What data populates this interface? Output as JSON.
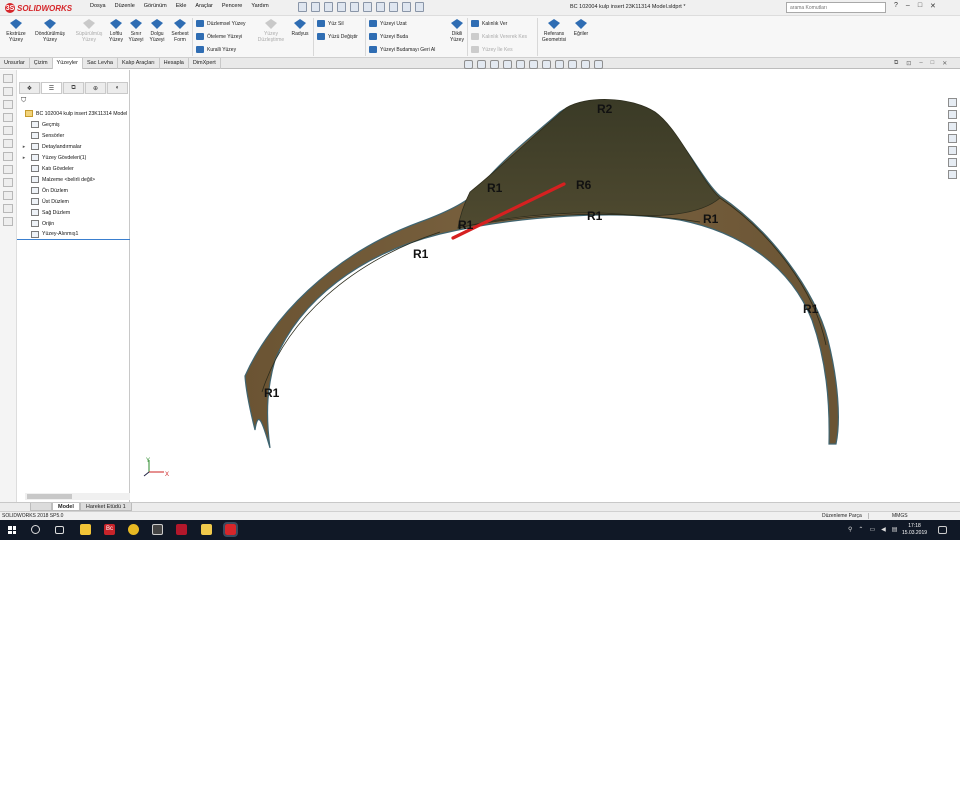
{
  "window": {
    "brand": "SOLIDWORKS",
    "brand_prefix": "3S",
    "document_title": "BC 102004 kulp insert 23K11314 Model.sldprt *",
    "search_placeholder": "arama Komutları",
    "controls": [
      "?",
      "–",
      "□",
      "✕"
    ]
  },
  "menu": [
    "Dosya",
    "Düzenle",
    "Görünüm",
    "Ekle",
    "Araçlar",
    "Pencere",
    "Yardım"
  ],
  "ribbon": {
    "big_buttons": [
      {
        "label1": "Ekstrüze",
        "label2": "Yüzey",
        "enabled": true
      },
      {
        "label1": "Döndürülmüş",
        "label2": "Yüzey",
        "enabled": true
      },
      {
        "label1": "Süpürülmüş",
        "label2": "Yüzey",
        "enabled": false
      },
      {
        "label1": "Loftlu",
        "label2": "Yüzey",
        "enabled": true
      },
      {
        "label1": "Sınır",
        "label2": "Yüzeyi",
        "enabled": true
      },
      {
        "label1": "Dolgu",
        "label2": "Yüzeyi",
        "enabled": true
      },
      {
        "label1": "Serbest",
        "label2": "Form",
        "enabled": true
      }
    ],
    "col1": [
      "Düzlemsel Yüzey",
      "Öteleme Yüzeyi",
      "Kuralli Yüzey"
    ],
    "radius": {
      "label": "Radyus"
    },
    "flatten": {
      "label1": "Yüzey",
      "label2": "Düzleştirme"
    },
    "col2": [
      "Yüz Sil",
      "Yüzü Değiştir"
    ],
    "col3": [
      "Yüzeyi Uzat",
      "Yüzeyi Buda",
      "Yüzeyi Budamayı Geri Al"
    ],
    "ruled": {
      "label1": "Dikili",
      "label2": "Yüzey"
    },
    "col4": [
      {
        "label": "Kalınlık Ver",
        "enabled": true
      },
      {
        "label": "Kalınlık Vererek Kes",
        "enabled": false
      },
      {
        "label": "Yüzey İle Kes",
        "enabled": false
      }
    ],
    "ref_geom": {
      "label1": "Referans",
      "label2": "Geometrisi"
    },
    "curves": {
      "label": "Eğriler"
    }
  },
  "tabs": [
    "Unsurlar",
    "Çizim",
    "Yüzeyler",
    "Sac Levha",
    "Kalıp Araçları",
    "Hesapla",
    "DimXpert"
  ],
  "active_tab": "Yüzeyler",
  "tree": [
    {
      "label": "BC 102004 kulp insert 23K11314 Model",
      "expand": ""
    },
    {
      "label": "Geçmiş",
      "expand": ""
    },
    {
      "label": "Sensörler",
      "expand": ""
    },
    {
      "label": "Detaylandırmalar",
      "expand": "▸"
    },
    {
      "label": "Yüzey Gövdeleri(1)",
      "expand": "▸"
    },
    {
      "label": "Katı Gövdeler",
      "expand": ""
    },
    {
      "label": "Malzeme <belirli değil>",
      "expand": ""
    },
    {
      "label": "Ön Düzlem",
      "expand": ""
    },
    {
      "label": "Üst Düzlem",
      "expand": ""
    },
    {
      "label": "Sağ Düzlem",
      "expand": ""
    },
    {
      "label": "Orijin",
      "expand": ""
    },
    {
      "label": "Yüzey-Alınmış1",
      "expand": ""
    }
  ],
  "model_labels": [
    {
      "text": "R2"
    },
    {
      "text": "R6"
    },
    {
      "text": "R1"
    },
    {
      "text": "R1"
    },
    {
      "text": "R1"
    },
    {
      "text": "R1"
    },
    {
      "text": "R1"
    },
    {
      "text": "R1"
    },
    {
      "text": "R1"
    }
  ],
  "triad": {
    "y": "Y",
    "x": "X"
  },
  "bottom_tabs": [
    "",
    "Model",
    "Hareket Etüdü 1"
  ],
  "status": {
    "version": "SOLIDWORKS 2018 SP5.0",
    "mode": "Düzenleme Parça",
    "units": "MMGS"
  },
  "taskbar": {
    "time": "17:18",
    "date": "15.03.2019",
    "apps": [
      "folder",
      "Bc",
      "chrome",
      "calculator",
      "pdf",
      "explorer",
      "solidworks"
    ],
    "colors": {
      "accent": "#d6262a",
      "taskbar": "#101826",
      "model": "#6e5a3a"
    }
  }
}
